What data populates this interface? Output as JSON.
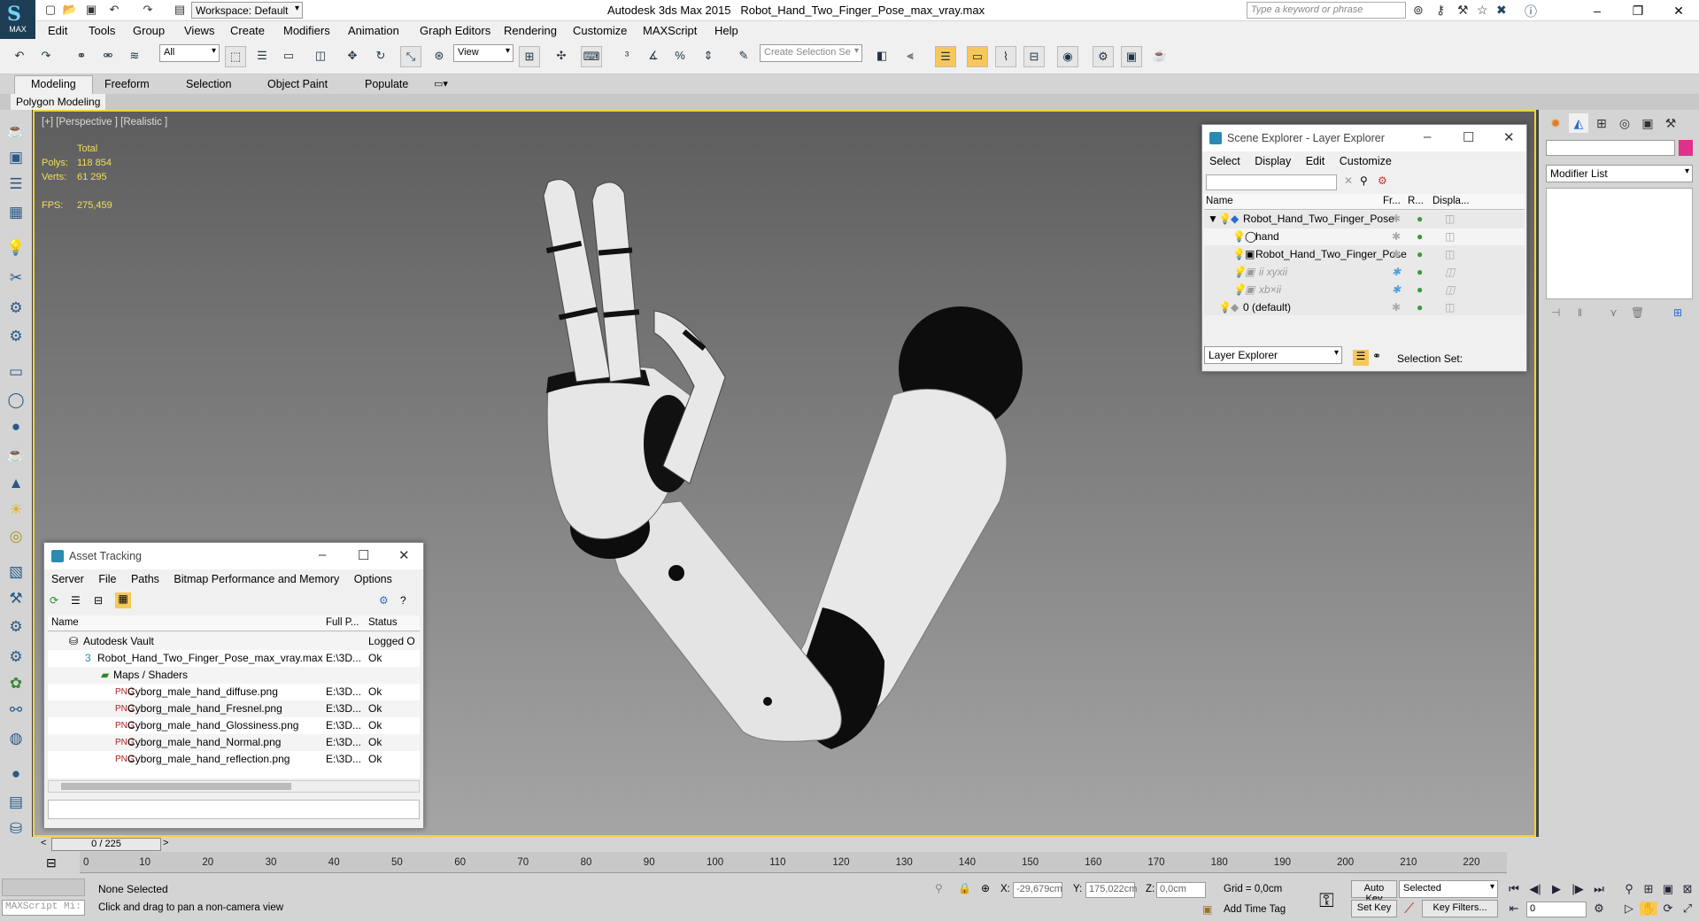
{
  "titlebar": {
    "workspace": "Workspace: Default",
    "app": "Autodesk 3ds Max  2015",
    "file": "Robot_Hand_Two_Finger_Pose_max_vray.max",
    "search_placeholder": "Type a keyword or phrase",
    "logo_text": "MAX"
  },
  "menu": [
    "Edit",
    "Tools",
    "Group",
    "Views",
    "Create",
    "Modifiers",
    "Animation",
    "Graph Editors",
    "Rendering",
    "Customize",
    "MAXScript",
    "Help"
  ],
  "toolbar": {
    "filter": "All",
    "refcoord": "View",
    "selset_placeholder": "Create Selection Se"
  },
  "ribbon": {
    "tabs": [
      "Modeling",
      "Freeform",
      "Selection",
      "Object Paint",
      "Populate"
    ],
    "sub": "Polygon Modeling"
  },
  "viewport": {
    "label": "[+] [Perspective ] [Realistic ]",
    "stats": {
      "total": "Total",
      "polys_label": "Polys:",
      "polys": "118 854",
      "verts_label": "Verts:",
      "verts": "61 295",
      "fps_label": "FPS:",
      "fps": "275,459"
    }
  },
  "scene_explorer": {
    "title": "Scene Explorer - Layer Explorer",
    "menu": [
      "Select",
      "Display",
      "Edit",
      "Customize"
    ],
    "cols": [
      "Name",
      "Fr...",
      "R...",
      "Displa..."
    ],
    "rows": [
      {
        "name": "Robot_Hand_Two_Finger_Pose"
      },
      {
        "name": "hand"
      },
      {
        "name": "Robot_Hand_Two_Finger_Pose"
      },
      {
        "name": "ii xyxii"
      },
      {
        "name": "xb×ii"
      },
      {
        "name": "0 (default)"
      }
    ],
    "footer_dd": "Layer Explorer",
    "footer_label": "Selection Set:"
  },
  "asset_tracking": {
    "title": "Asset Tracking",
    "menu": [
      "Server",
      "File",
      "Paths",
      "Bitmap Performance and Memory",
      "Options"
    ],
    "cols": [
      "Name",
      "Full P...",
      "Status"
    ],
    "rows": [
      {
        "name": "Autodesk Vault",
        "path": "",
        "status": "Logged O"
      },
      {
        "name": "Robot_Hand_Two_Finger_Pose_max_vray.max",
        "path": "E:\\3D...",
        "status": "Ok"
      },
      {
        "name": "Maps / Shaders",
        "path": "",
        "status": ""
      },
      {
        "name": "Cyborg_male_hand_diffuse.png",
        "path": "E:\\3D...",
        "status": "Ok"
      },
      {
        "name": "Cyborg_male_hand_Fresnel.png",
        "path": "E:\\3D...",
        "status": "Ok"
      },
      {
        "name": "Cyborg_male_hand_Glossiness.png",
        "path": "E:\\3D...",
        "status": "Ok"
      },
      {
        "name": "Cyborg_male_hand_Normal.png",
        "path": "E:\\3D...",
        "status": "Ok"
      },
      {
        "name": "Cyborg_male_hand_reflection.png",
        "path": "E:\\3D...",
        "status": "Ok"
      }
    ]
  },
  "modifier_panel": {
    "list": "Modifier List"
  },
  "timeline": {
    "frame": "0 / 225",
    "ticks": [
      "0",
      "10",
      "20",
      "30",
      "40",
      "50",
      "60",
      "70",
      "80",
      "90",
      "100",
      "110",
      "120",
      "130",
      "140",
      "150",
      "160",
      "170",
      "180",
      "190",
      "200",
      "210",
      "220"
    ]
  },
  "status": {
    "maxscript": "MAXScript Mi:",
    "selection": "None Selected",
    "prompt": "Click and drag to pan a non-camera view",
    "x_label": "X:",
    "x": "-29,679cm",
    "y_label": "Y:",
    "y": "175,022cm",
    "z_label": "Z:",
    "z": "0,0cm",
    "grid": "Grid = 0,0cm",
    "add_time_tag": "Add Time Tag",
    "auto_key": "Auto Key",
    "set_key": "Set Key",
    "key_mode": "Selected",
    "key_filters": "Key Filters...",
    "frame_field": "0"
  }
}
